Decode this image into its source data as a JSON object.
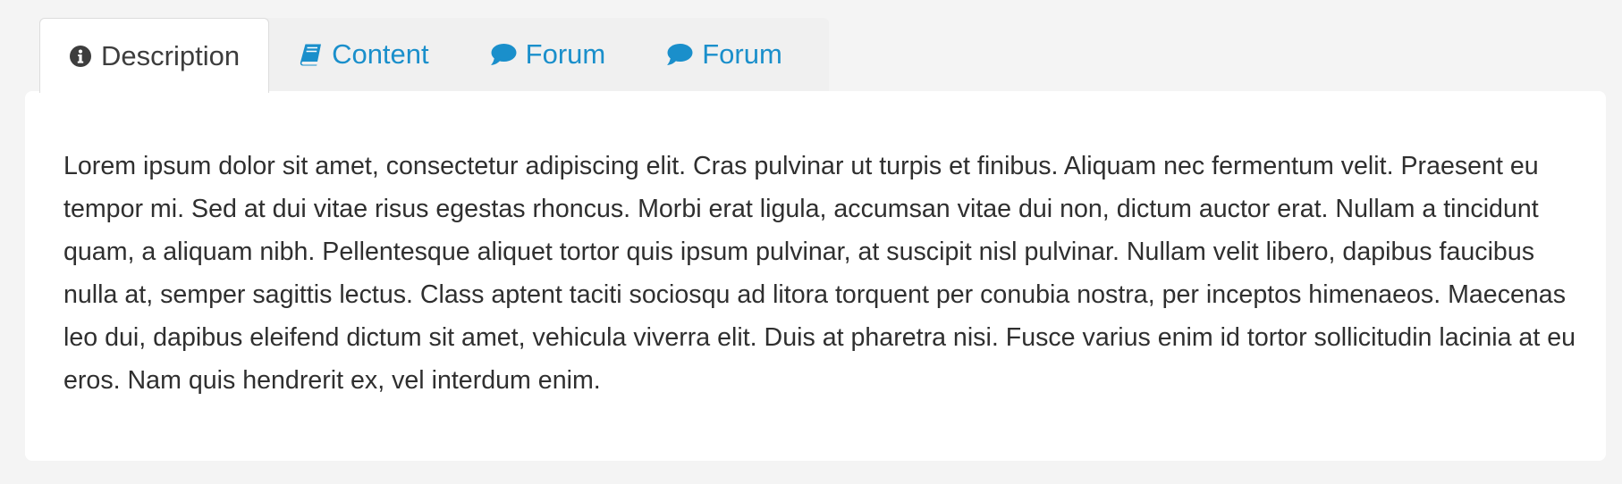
{
  "tabs": [
    {
      "label": "Description",
      "icon": "info-circle-icon",
      "active": true
    },
    {
      "label": "Content",
      "icon": "book-icon",
      "active": false
    },
    {
      "label": "Forum",
      "icon": "comment-icon",
      "active": false
    },
    {
      "label": "Forum",
      "icon": "comment-icon",
      "active": false
    }
  ],
  "colors": {
    "page_background": "#f4f4f4",
    "tab_bar_background": "#f0f0f0",
    "link": "#1a8fcb",
    "active_tab_text": "#3d3d3d",
    "body_text": "#2f2f2f",
    "panel_background": "#ffffff"
  },
  "panel": {
    "text": "Lorem ipsum dolor sit amet, consectetur adipiscing elit. Cras pulvinar ut turpis et finibus. Aliquam nec fermentum velit. Praesent eu tempor mi. Sed at dui vitae risus egestas rhoncus. Morbi erat ligula, accumsan vitae dui non, dictum auctor erat. Nullam a tincidunt quam, a aliquam nibh. Pellentesque aliquet tortor quis ipsum pulvinar, at suscipit nisl pulvinar. Nullam velit libero, dapibus faucibus nulla at, semper sagittis lectus. Class aptent taciti sociosqu ad litora torquent per conubia nostra, per inceptos himenaeos. Maecenas leo dui, dapibus eleifend dictum sit amet, vehicula viverra elit. Duis at pharetra nisi. Fusce varius enim id tortor sollicitudin lacinia at eu eros. Nam quis hendrerit ex, vel interdum enim."
  }
}
